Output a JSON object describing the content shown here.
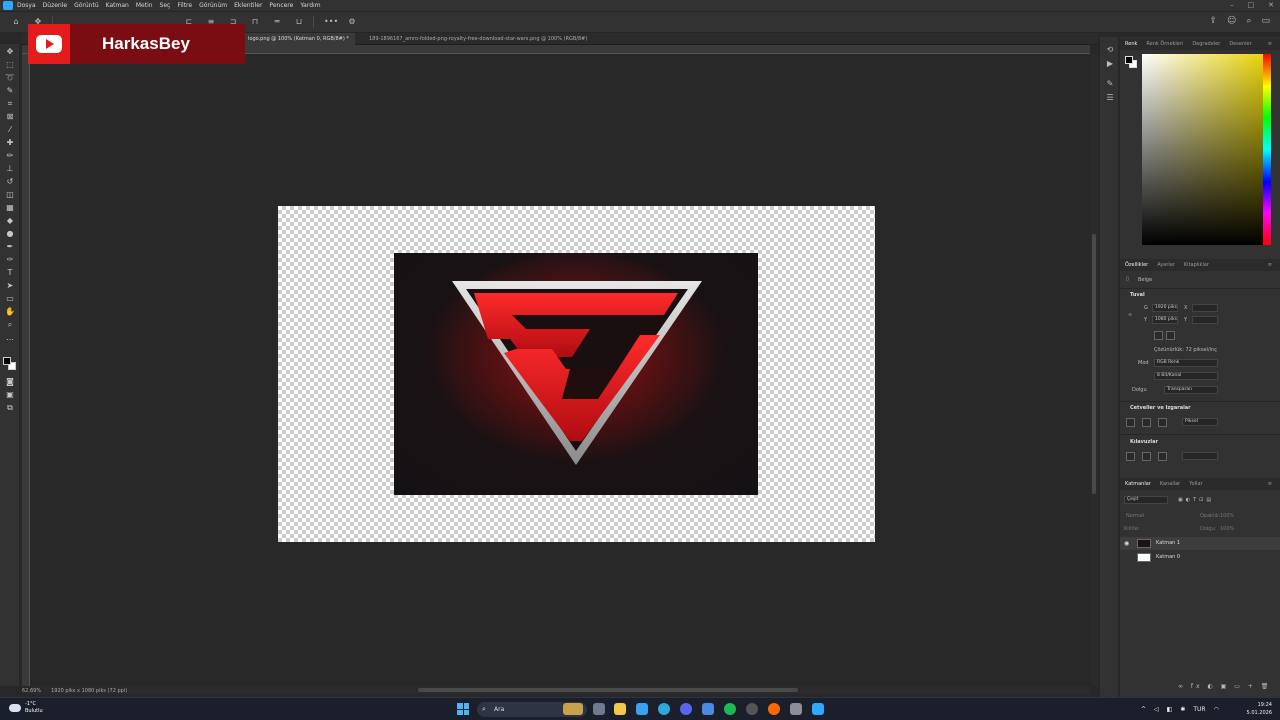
{
  "menubar": {
    "items": [
      "Dosya",
      "Düzenle",
      "Görüntü",
      "Katman",
      "Metin",
      "Seç",
      "Filtre",
      "Görünüm",
      "Eklentiler",
      "Pencere",
      "Yardım"
    ]
  },
  "overlay": {
    "channel_name": "HarkasBey"
  },
  "tabs": [
    {
      "label": "logo.png @ 100% (Katman 0, RGB/8#) *"
    },
    {
      "label": "189-1896167_amro-folded-png-royalty-free-download-star-wars.png @ 100% (RGB/8#)"
    }
  ],
  "status": {
    "zoom": "62,69%",
    "doc_info": "1920 piks x 1080 piks (72 ppi)"
  },
  "panels": {
    "color_tabs": [
      "Renk",
      "Renk Örnekleri",
      "Degradeler",
      "Desenler"
    ],
    "props_tabs": [
      "Özellikler",
      "Ayarlar",
      "Kitaplıklar"
    ],
    "doc_label": "Belge",
    "canvas_section": "Tuval",
    "w_label": "G",
    "w_value": "1920 piks",
    "h_label": "Y",
    "h_value": "1080 piks",
    "x_label": "X",
    "y_label": "Y",
    "resolution": "Çözünürlük: 72 piksel/inç",
    "mode_label": "Mod",
    "mode_value": "RGB Renk",
    "depth_value": "8 Bit/Kanal",
    "fill_label": "Dolgu",
    "fill_value": "Transparan",
    "rulers_section": "Cetveller ve Izgaralar",
    "unit_value": "Piksel",
    "guides_section": "Kılavuzlar",
    "layers_tabs": [
      "Katmanlar",
      "Kanallar",
      "Yollar"
    ],
    "layer_filter": "Çeşit",
    "blend_mode": "Normal",
    "opacity_label": "Opaklık:",
    "opacity_value": "100%",
    "lock_label": "Kilitle:",
    "fill_layer_label": "Dolgu:",
    "fill_layer_value": "100%",
    "layers": [
      {
        "name": "Katman 1",
        "visible": true
      },
      {
        "name": "Katman 0",
        "visible": false
      }
    ]
  },
  "taskbar": {
    "temperature": "-1°C",
    "weather": "Bulutlu",
    "search_placeholder": "Ara",
    "language": "TUR",
    "time": "19:24",
    "date": "5.01.2026"
  },
  "colors": {
    "accent_blue": "#31a8ff",
    "youtube_red": "#e41b1b",
    "banner_dark_red": "#7a0d12"
  }
}
